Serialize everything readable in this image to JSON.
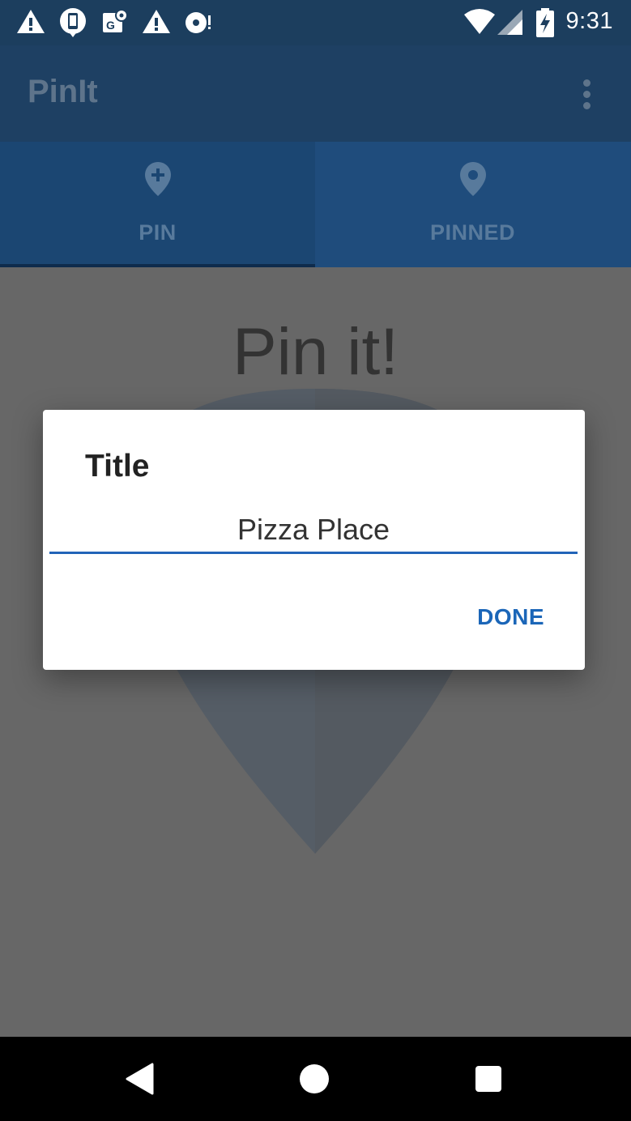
{
  "status_bar": {
    "time": "9:31",
    "icons": [
      "alert-icon",
      "phone-notification-icon",
      "maps-icon",
      "alert-icon",
      "dropbox-icon",
      "wifi-icon",
      "signal-icon",
      "battery-charging-icon"
    ]
  },
  "app_bar": {
    "title": "PinIt",
    "menu_icon": "more-vert-icon"
  },
  "tabs": [
    {
      "label": "PIN",
      "icon": "add-location-icon",
      "selected": true
    },
    {
      "label": "PINNED",
      "icon": "location-icon",
      "selected": false
    }
  ],
  "content": {
    "heading": "Pin it!"
  },
  "dialog": {
    "title": "Title",
    "input_value": "Pizza Place",
    "done_label": "DONE"
  },
  "nav_bar": {
    "icons": [
      "back-icon",
      "home-icon",
      "recents-icon"
    ]
  },
  "colors": {
    "status_bar": "#1c3e5e",
    "app_bar": "#1e4063",
    "accent": "#1b66b8",
    "scrim_content": "#676767"
  }
}
